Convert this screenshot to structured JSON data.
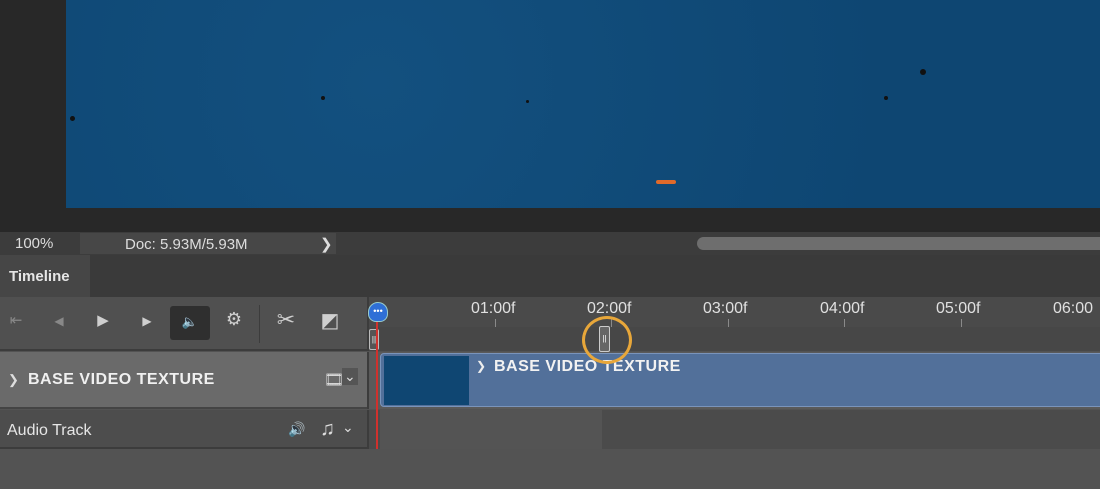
{
  "status": {
    "zoom": "100%",
    "doc": "Doc: 5.93M/5.93M",
    "arrow": "❯"
  },
  "panel": {
    "tab": "Timeline"
  },
  "controls": {
    "first": "⇤",
    "prev": "◀",
    "play": "▶",
    "next": "▶",
    "mute": "🔈",
    "gear": "⚙",
    "cut": "✂",
    "transition": "◩"
  },
  "ruler": {
    "labels": [
      "01:00f",
      "02:00f",
      "03:00f",
      "04:00f",
      "05:00f",
      "06:00"
    ]
  },
  "tracks": {
    "video": {
      "name": "BASE VIDEO TEXTURE",
      "expand": "❯",
      "film": "🎞",
      "chevron": "⌄"
    },
    "audio": {
      "name": "Audio Track",
      "speaker": "🔊",
      "note": "♫",
      "chevron": "⌄"
    }
  },
  "clip": {
    "name": "BASE VIDEO TEXTURE",
    "expand": "❯"
  },
  "playhead": {
    "glyph": "•••"
  },
  "colors": {
    "accent": "#e8a73a",
    "playhead": "#d0312d",
    "clip": "#52709a"
  }
}
